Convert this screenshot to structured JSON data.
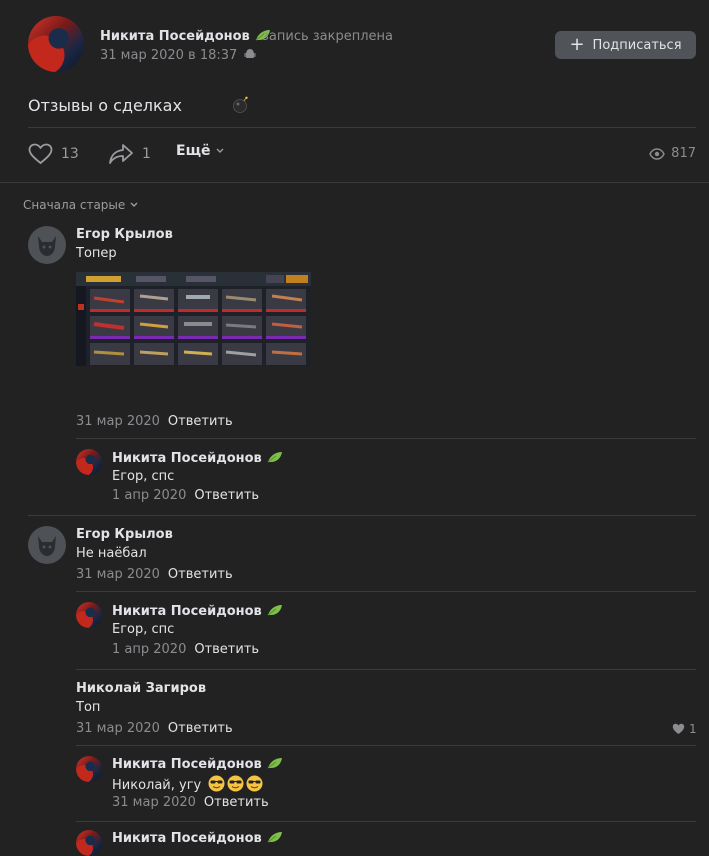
{
  "post": {
    "author": "Никита Посейдонов",
    "pinned_label": "запись закреплена",
    "date": "31 мар 2020 в 18:37",
    "subscribe_label": "Подписаться",
    "text": "Отзывы о сделках",
    "likes": "13",
    "shares": "1",
    "more_label": "Ещё",
    "views": "817"
  },
  "comments_sort": "Сначала старые",
  "comments": [
    {
      "author": "Егор Крылов",
      "text": "Топер",
      "date": "31 мар 2020",
      "reply_label": "Ответить"
    },
    {
      "author": "Никита Посейдонов",
      "text": "Егор, спс",
      "date": "1 апр 2020",
      "reply_label": "Ответить"
    },
    {
      "author": "Егор Крылов",
      "text": "Не наёбал",
      "date": "31 мар 2020",
      "reply_label": "Ответить"
    },
    {
      "author": "Никита Посейдонов",
      "text": "Егор, спс",
      "date": "1 апр 2020",
      "reply_label": "Ответить"
    },
    {
      "author": "Николай Загиров",
      "text": "Топ",
      "date": "31 мар 2020",
      "reply_label": "Ответить",
      "likes": "1"
    },
    {
      "author": "Никита Посейдонов",
      "text": "Николай, угу",
      "date": "31 мар 2020",
      "reply_label": "Ответить"
    },
    {
      "author": "Никита Посейдонов"
    }
  ],
  "colors": {
    "background": "#222222",
    "text": "#e1e3e6",
    "secondary_text": "#8a8c90",
    "button_bg": "#505357",
    "divider": "#3a3a3a",
    "leaf_icon": "#7fbf4a"
  },
  "icons": {
    "leaf": "leaf-icon",
    "like": "heart-icon",
    "share": "share-arrow-icon",
    "views": "eye-icon",
    "android": "android-icon",
    "emoji": "sunglasses-emoji-icon",
    "bomb": "bomb-emoji-icon"
  }
}
